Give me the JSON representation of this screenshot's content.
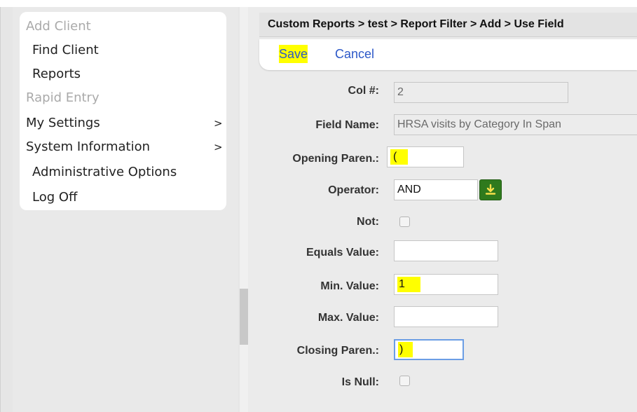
{
  "nav": {
    "items": [
      {
        "label": "Add Client",
        "disabled": true
      },
      {
        "label": "Find Client",
        "disabled": false
      },
      {
        "label": "Reports",
        "disabled": false
      },
      {
        "label": "Rapid Entry",
        "disabled": true
      },
      {
        "label": "My Settings",
        "disabled": false,
        "submenu": true
      },
      {
        "label": "System Information",
        "disabled": false,
        "submenu": true
      },
      {
        "label": "Administrative Options",
        "disabled": false
      },
      {
        "label": "Log Off",
        "disabled": false
      }
    ],
    "chevron_glyph": ">"
  },
  "breadcrumb": "Custom Reports > test > Report Filter > Add > Use Field",
  "toolbar": {
    "save_label": "Save",
    "cancel_label": "Cancel"
  },
  "form": {
    "col_num_label": "Col #:",
    "col_num_value": "2",
    "field_name_label": "Field Name:",
    "field_name_value": "HRSA visits by Category In Span",
    "opening_paren_label": "Opening Paren.:",
    "opening_paren_value": "(",
    "operator_label": "Operator:",
    "operator_value": "AND",
    "not_label": "Not:",
    "not_checked": false,
    "equals_label": "Equals Value:",
    "equals_value": "",
    "min_label": "Min. Value:",
    "min_value": "1",
    "max_label": "Max. Value:",
    "max_value": "",
    "closing_paren_label": "Closing Paren.:",
    "closing_paren_value": ")",
    "is_null_label": "Is Null:",
    "is_null_checked": false
  },
  "icons": {
    "dropdown": "download-arrow-icon",
    "chevron": "chevron-right-icon"
  },
  "colors": {
    "highlight": "#ffff00",
    "link": "#2c58c8",
    "dropdown_button": "#2f7a1d",
    "focus_border": "#6b9ee5"
  }
}
